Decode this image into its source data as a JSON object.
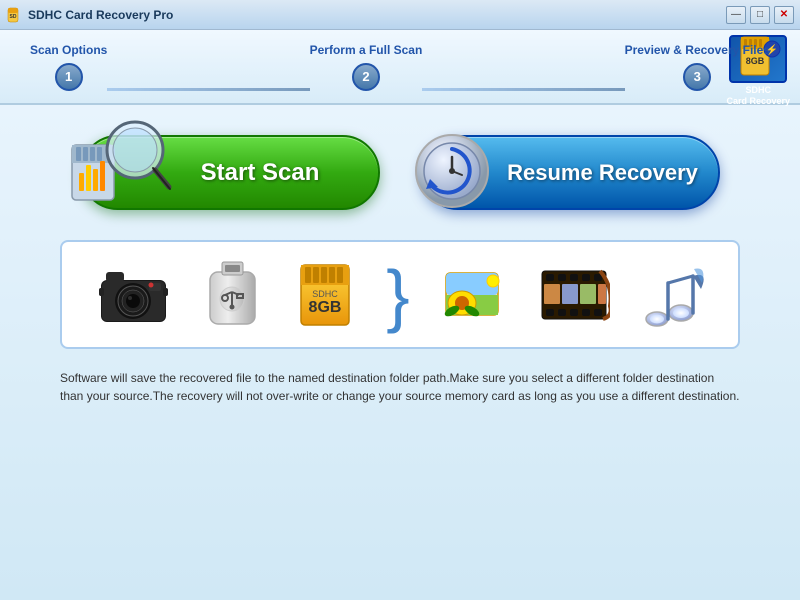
{
  "titlebar": {
    "title": "SDHC Card Recovery Pro",
    "minimize_label": "—",
    "maximize_label": "□",
    "close_label": "✕"
  },
  "steps": [
    {
      "label": "Scan Options",
      "number": "1"
    },
    {
      "label": "Perform a Full Scan",
      "number": "2"
    },
    {
      "label": "Preview & Recovery Files",
      "number": "3"
    }
  ],
  "logo": {
    "line1": "SDHC",
    "line2": "Card Recovery"
  },
  "buttons": {
    "start_scan": "Start Scan",
    "resume_recovery": "Resume Recovery"
  },
  "icons": [
    {
      "name": "camera",
      "label": "Camera"
    },
    {
      "name": "usb-drive",
      "label": "USB Drive"
    },
    {
      "name": "sd-card",
      "label": "SD Card"
    },
    {
      "name": "photo",
      "label": "Photos"
    },
    {
      "name": "film",
      "label": "Videos"
    },
    {
      "name": "music",
      "label": "Music"
    }
  ],
  "info_text": "Software will save the recovered file to the named destination folder path.Make sure you select a different folder destination than your source.The recovery will not over-write or change your source memory card as long as you use a different destination.",
  "colors": {
    "start_scan_bg": "#44aa22",
    "resume_bg": "#2277cc",
    "accent": "#2255aa"
  }
}
